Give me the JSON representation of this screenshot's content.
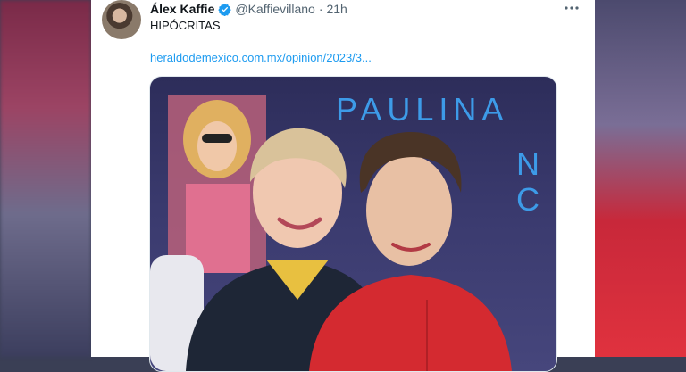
{
  "tweet": {
    "author_name": "Álex Kaffie",
    "handle": "@Kaffievillano",
    "separator": "·",
    "time": "21h",
    "text": "HIPÓCRITAS",
    "link": "heraldodemexico.com.mx/opinion/2023/3..."
  },
  "media": {
    "banner_text": "PAULINA",
    "banner_color": "#3d9be8"
  },
  "icons": {
    "verified": "verified-badge-icon",
    "more": "more-options-icon"
  },
  "colors": {
    "accent": "#1d9bf0",
    "text": "#0f1419",
    "secondary": "#536471"
  }
}
